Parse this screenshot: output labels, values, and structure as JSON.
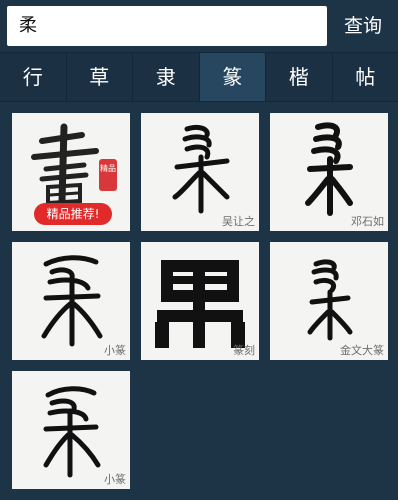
{
  "search": {
    "value": "柔",
    "button_label": "查询"
  },
  "tabs": [
    {
      "label": "行",
      "active": false
    },
    {
      "label": "草",
      "active": false
    },
    {
      "label": "隶",
      "active": false
    },
    {
      "label": "篆",
      "active": true
    },
    {
      "label": "楷",
      "active": false
    },
    {
      "label": "帖",
      "active": false
    }
  ],
  "cards": [
    {
      "type": "promo",
      "badge": "精品推荐!",
      "seal_text": "精品",
      "icon": "calligraphy-brush-logo"
    },
    {
      "type": "glyph",
      "caption": "吴让之",
      "icon": "seal-script-rou-variant-1"
    },
    {
      "type": "glyph",
      "caption": "邓石如",
      "icon": "seal-script-rou-variant-2"
    },
    {
      "type": "glyph",
      "caption": "小篆",
      "icon": "seal-script-rou-variant-3"
    },
    {
      "type": "glyph",
      "caption": "篆刻",
      "icon": "seal-carving-rou-bold"
    },
    {
      "type": "glyph",
      "caption": "金文大篆",
      "icon": "bronze-script-rou"
    },
    {
      "type": "glyph",
      "caption": "小篆",
      "icon": "seal-script-rou-variant-4"
    }
  ],
  "colors": {
    "background": "#1d3346",
    "active_tab": "#27465f",
    "badge": "#e22a2a",
    "card": "#f4f4f2"
  }
}
